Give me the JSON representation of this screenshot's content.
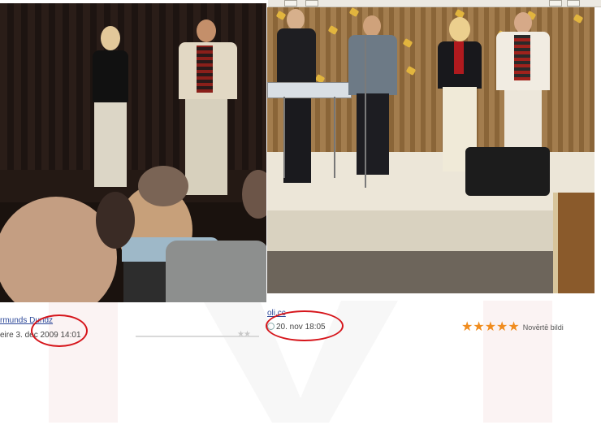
{
  "photo1": {
    "alt": "Concert photo with audience"
  },
  "photo2": {
    "alt": "Band performing on stage"
  },
  "captions": {
    "author1": "rmunds Dundz",
    "date1": "eire 3. dec 2009 14:01",
    "author2": "oli.cc",
    "date2": "20. nov 18:05"
  },
  "rating": {
    "stars": 5,
    "max": 5,
    "label": "Novērtē bildi",
    "color": "#f08c1e"
  },
  "markers": {
    "color": "#d6151b"
  }
}
